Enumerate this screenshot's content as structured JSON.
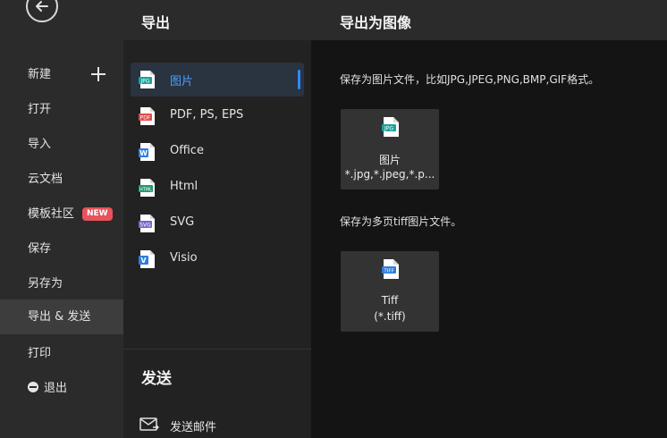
{
  "left_nav": {
    "items": [
      {
        "label": "新建"
      },
      {
        "label": "打开"
      },
      {
        "label": "导入"
      },
      {
        "label": "云文档"
      },
      {
        "label": "模板社区",
        "badge": "NEW"
      },
      {
        "label": "保存"
      },
      {
        "label": "另存为"
      },
      {
        "label": "导出 & 发送"
      },
      {
        "label": "打印"
      },
      {
        "label": "退出"
      }
    ]
  },
  "export_panel": {
    "title": "导出",
    "formats": [
      {
        "label": "图片",
        "icon_text": "JPG",
        "color": "#1aa39a"
      },
      {
        "label": "PDF, PS, EPS",
        "icon_text": "PDF",
        "color": "#e24b4b"
      },
      {
        "label": "Office",
        "icon_text": "W",
        "color": "#2f7de1"
      },
      {
        "label": "Html",
        "icon_text": "HTML",
        "color": "#1f9a6b"
      },
      {
        "label": "SVG",
        "icon_text": "SVG",
        "color": "#7a63c9"
      },
      {
        "label": "Visio",
        "icon_text": "V",
        "color": "#2f7de1"
      }
    ],
    "send_title": "发送",
    "send_items": [
      {
        "label": "发送邮件"
      }
    ]
  },
  "content": {
    "title": "导出为图像",
    "image_desc": "保存为图片文件，比如JPG,JPEG,PNG,BMP,GIF格式。",
    "image_tile": {
      "line1": "图片",
      "line2": "*.jpg,*.jpeg,*.p...",
      "icon_text": "JPG"
    },
    "tiff_desc": "保存为多页tiff图片文件。",
    "tiff_tile": {
      "line1": "Tiff",
      "line2": "(*.tiff)",
      "icon_text": "TIFF"
    }
  },
  "colors": {
    "accent": "#2f88ff",
    "badge": "#e8525b"
  }
}
